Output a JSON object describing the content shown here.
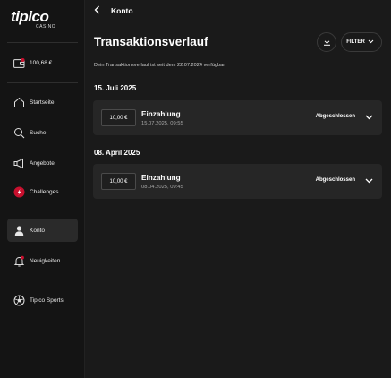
{
  "app": {
    "logo_text": "tipico",
    "logo_sub": "CASINO"
  },
  "sidebar": {
    "balance": "100,68 €",
    "items": [
      {
        "label": "Startseite",
        "icon": "home-icon"
      },
      {
        "label": "Suche",
        "icon": "search-icon"
      },
      {
        "label": "Angebote",
        "icon": "megaphone-icon"
      },
      {
        "label": "Challenges",
        "icon": "challenges-icon"
      },
      {
        "label": "Konto",
        "icon": "user-icon",
        "active": true
      },
      {
        "label": "Neuigkeiten",
        "icon": "bell-icon"
      },
      {
        "label": "Tipico Sports",
        "icon": "soccer-ball-icon"
      }
    ]
  },
  "header": {
    "breadcrumb": "Konto",
    "title": "Transaktionsverlauf",
    "filter_label": "FILTER"
  },
  "info_text": "Dein Transaktionsverlauf ist seit dem 22.07.2024 verfügbar.",
  "groups": [
    {
      "date": "15. Juli 2025",
      "transactions": [
        {
          "amount": "10,00 €",
          "type": "Einzahlung",
          "datetime": "15.07.2025, 09:55",
          "status": "Abgeschlossen"
        }
      ]
    },
    {
      "date": "08. April 2025",
      "transactions": [
        {
          "amount": "10,00 €",
          "type": "Einzahlung",
          "datetime": "08.04.2025, 09:45",
          "status": "Abgeschlossen"
        }
      ]
    }
  ],
  "colors": {
    "background": "#1a1a1a",
    "sidebar": "#141414",
    "card": "#262626",
    "accent_red": "#c8102e"
  }
}
